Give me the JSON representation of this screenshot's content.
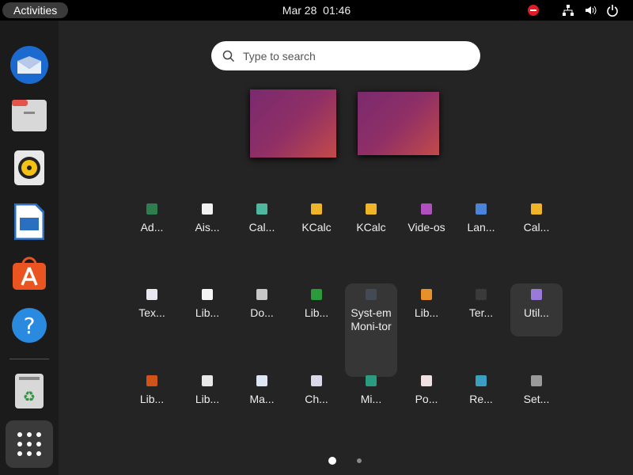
{
  "topbar": {
    "activities": "Activities",
    "date": "Mar 28",
    "time": "01:46"
  },
  "dock": [
    {
      "name": "thunderbird"
    },
    {
      "name": "files"
    },
    {
      "name": "rhythmbox"
    },
    {
      "name": "libreoffice-writer"
    },
    {
      "name": "app-center"
    },
    {
      "name": "help"
    },
    {
      "name": "trash"
    },
    {
      "name": "show-apps"
    }
  ],
  "search": {
    "placeholder": "Type to search",
    "value": ""
  },
  "apps": [
    {
      "label": "Ad...",
      "color": "#2e7d4f"
    },
    {
      "label": "Ais...",
      "color": "#f2f2f2"
    },
    {
      "label": "Cal...",
      "color": "#4fb6a0"
    },
    {
      "label": "KCalc",
      "color": "#f0b429"
    },
    {
      "label": "KCalc",
      "color": "#f0b429"
    },
    {
      "label": "Vide-os",
      "color": "#b04fc0"
    },
    {
      "label": "Lan...",
      "color": "#4a84d8"
    },
    {
      "label": "Cal...",
      "color": "#f0b429"
    },
    {
      "label": "Tex...",
      "color": "#e8e8f0"
    },
    {
      "label": "Lib...",
      "color": "#f5f5f5"
    },
    {
      "label": "Do...",
      "color": "#c8c8c8"
    },
    {
      "label": "Lib...",
      "color": "#2a9a3a"
    },
    {
      "label": "Syst-em Moni-tor",
      "color": "#444a55",
      "highlight": true
    },
    {
      "label": "Lib...",
      "color": "#e8902a"
    },
    {
      "label": "Ter...",
      "color": "#3a3a3a"
    },
    {
      "label": "Util...",
      "color": "#9a7ad8",
      "highlight": true
    },
    {
      "label": "Lib...",
      "color": "#d0541a"
    },
    {
      "label": "Lib...",
      "color": "#e8e8e8"
    },
    {
      "label": "Ma...",
      "color": "#dde6f5"
    },
    {
      "label": "Ch...",
      "color": "#d8d8e8"
    },
    {
      "label": "Mi...",
      "color": "#2a9a80"
    },
    {
      "label": "Po...",
      "color": "#f0e0e0"
    },
    {
      "label": "Re...",
      "color": "#3aa0c0"
    },
    {
      "label": "Set...",
      "color": "#9a9a9a"
    }
  ],
  "pages": {
    "count": 2,
    "current": 1
  }
}
